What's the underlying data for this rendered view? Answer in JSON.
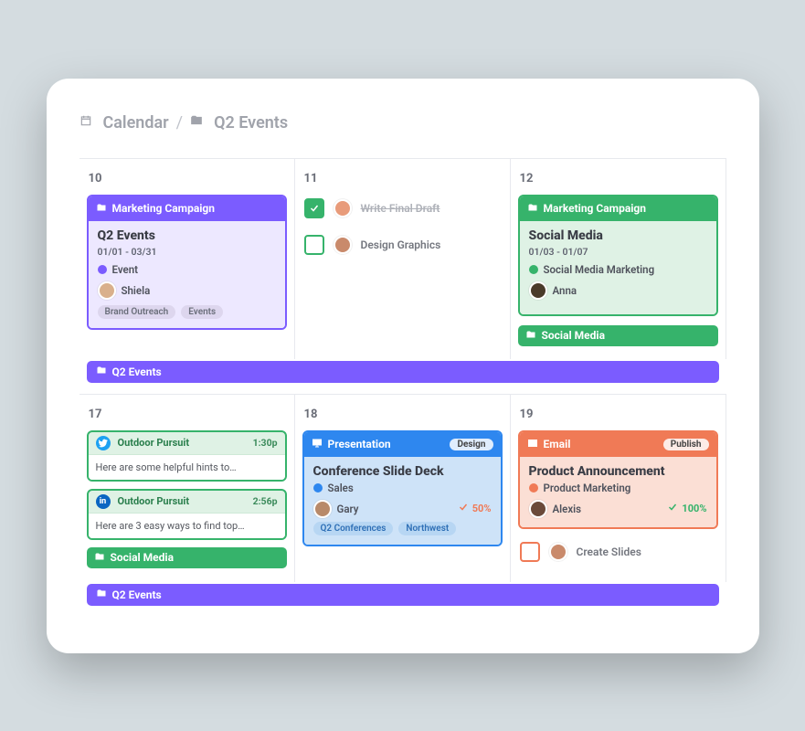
{
  "breadcrumb": {
    "root": "Calendar",
    "current": "Q2 Events"
  },
  "days": {
    "d10": "10",
    "d11": "11",
    "d12": "12",
    "d17": "17",
    "d18": "18",
    "d19": "19"
  },
  "cards": {
    "q2events": {
      "folder": "Marketing Campaign",
      "title": "Q2 Events",
      "dates": "01/01 - 03/31",
      "status": "Event",
      "user": "Shiela",
      "tags": [
        "Brand Outreach",
        "Events"
      ]
    },
    "social": {
      "folder": "Marketing Campaign",
      "title": "Social Media",
      "dates": "01/03 - 01/07",
      "status": "Social Media Marketing",
      "user": "Anna"
    },
    "presentation": {
      "label": "Presentation",
      "pill": "Design",
      "title": "Conference Slide Deck",
      "status": "Sales",
      "user": "Gary",
      "progress": "50%",
      "tags": [
        "Q2 Conferences",
        "Northwest"
      ]
    },
    "email": {
      "label": "Email",
      "pill": "Publish",
      "title": "Product Announcement",
      "status": "Product Marketing",
      "user": "Alexis",
      "progress": "100%"
    }
  },
  "tasks": {
    "t1": "Write Final Draft",
    "t2": "Design Graphics",
    "t3": "Create Slides"
  },
  "posts": {
    "p1": {
      "net": "twitter",
      "title": "Outdoor Pursuit",
      "time": "1:30p",
      "body": "Here are some helpful hints to…"
    },
    "p2": {
      "net": "linkedin",
      "title": "Outdoor Pursuit",
      "time": "2:56p",
      "body": "Here are 3 easy ways to find top…"
    }
  },
  "bars": {
    "social": "Social Media",
    "q2events": "Q2 Events"
  }
}
